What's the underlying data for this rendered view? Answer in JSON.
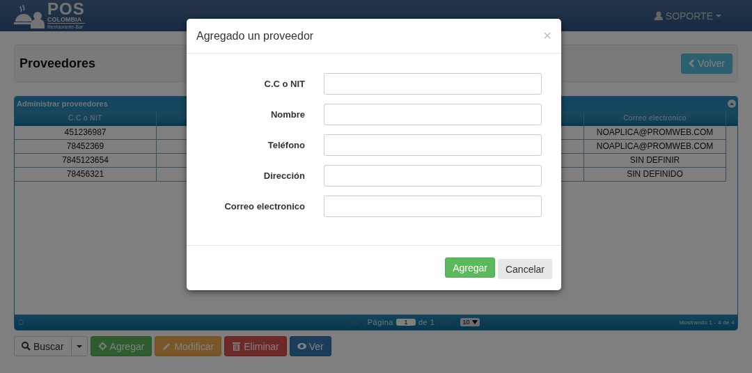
{
  "navbar": {
    "logo": {
      "title": "POS",
      "subtitle": "COLOMBIA",
      "tagline": "Restaurante-Bar"
    },
    "user": "SOPORTE"
  },
  "page_header": {
    "title": "Proveedores",
    "back_button": "Volver"
  },
  "grid": {
    "caption": "Administrar proveedores",
    "columns": [
      "C.C o NIT",
      "Correo electronico"
    ],
    "rows": [
      {
        "cc_nit": "451236987",
        "correo": "NOAPLICA@PROMWEB.COM"
      },
      {
        "cc_nit": "78452369",
        "correo": "NOAPLICA@PROMWEB.COM"
      },
      {
        "cc_nit": "7845123654",
        "correo": "SIN DEFINIR"
      },
      {
        "cc_nit": "78456321",
        "correo": "SIN DEFINIDO"
      }
    ],
    "pager": {
      "page_label": "Página",
      "page_value": "1",
      "of_label": "de 1",
      "page_size": "10",
      "info": "Mostrando 1 - 4 de 4"
    }
  },
  "toolbar": [
    {
      "label": "Buscar",
      "kind": "search"
    },
    {
      "label": "Agregar",
      "kind": "add"
    },
    {
      "label": "Modificar",
      "kind": "edit"
    },
    {
      "label": "Eliminar",
      "kind": "delete"
    },
    {
      "label": "Ver",
      "kind": "view"
    }
  ],
  "modal": {
    "title": "Agregado un proveedor",
    "close": "×",
    "fields": [
      {
        "label": "C.C o NIT"
      },
      {
        "label": "Nombre"
      },
      {
        "label": "Teléfono"
      },
      {
        "label": "Dirección"
      },
      {
        "label": "Correo electronico"
      }
    ],
    "buttons": [
      {
        "label": "Agregar",
        "kind": "primary"
      },
      {
        "label": "Cancelar",
        "kind": "default"
      }
    ]
  }
}
